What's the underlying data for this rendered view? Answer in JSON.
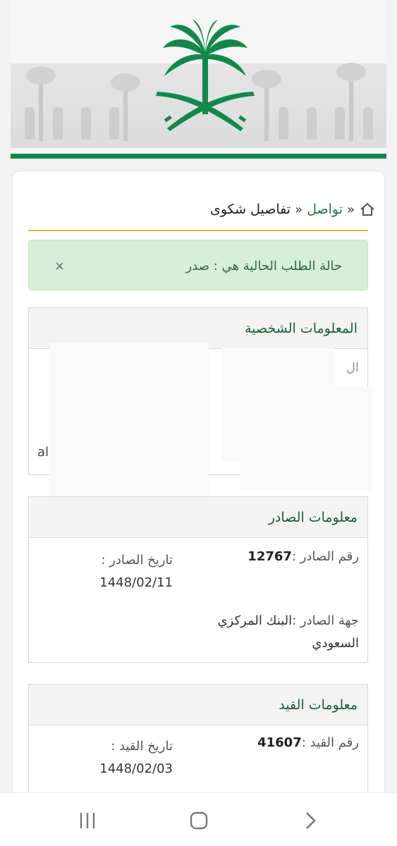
{
  "breadcrumb": {
    "link": "تواصل",
    "separator": "»",
    "current": "تفاصيل شكوى"
  },
  "alert": {
    "message": "حالة الطلب الحالية هي : صدر",
    "close": "×"
  },
  "personal": {
    "title": "المعلومات الشخصية",
    "partial_right": "ال",
    "partial_left": "al"
  },
  "outgoing": {
    "title": "معلومات الصادر",
    "number_label": "رقم الصادر :",
    "number_value": "12767",
    "date_label": "تاريخ الصادر :",
    "date_value": "1448/02/11",
    "issuer_label": "جهة الصادر :",
    "issuer_value_line1": "البنك المركزي",
    "issuer_value_line2": "السعودي"
  },
  "registration": {
    "title": "معلومات القيد",
    "number_label": "رقم القيد :",
    "number_value": "41607",
    "date_label": "تاريخ القيد :",
    "date_value": "1448/02/03"
  },
  "colors": {
    "brand_green": "#12894a",
    "gold_line": "#d8b93a",
    "alert_bg": "#d6efd9"
  },
  "icons": {
    "home": "home-icon",
    "nav_recent": "recent-apps-icon",
    "nav_home": "home-button-icon",
    "nav_back": "back-icon"
  }
}
